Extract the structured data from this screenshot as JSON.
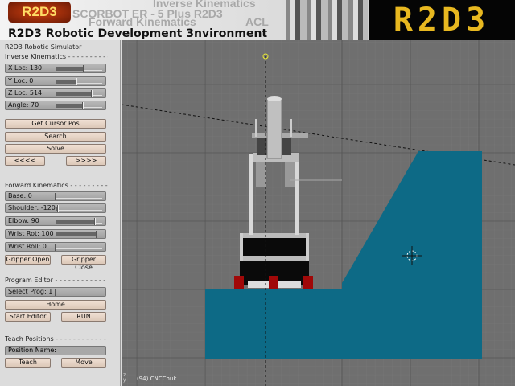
{
  "banner": {
    "logo_small": "R2D3",
    "logo_big": "R2D3",
    "ghost_texts": [
      "Inverse Kinematics",
      "SCORBOT ER - 5 Plus  R2D3",
      "Forward Kinematics",
      "ACL"
    ],
    "title": "R2D3 Robotic Development 3nvironment"
  },
  "panel": {
    "title": "R2D3 Robotic Simulator",
    "ik": {
      "heading": "Inverse Kinematics",
      "sliders": [
        {
          "label": "X Loc: 130",
          "value": 0.6
        },
        {
          "label": "Y Loc: 0",
          "value": 0.45
        },
        {
          "label": "Z Loc: 514",
          "value": 0.78
        },
        {
          "label": "Angle: 70",
          "value": 0.58
        }
      ],
      "get_cursor": "Get Cursor Pos",
      "search": "Search",
      "solve": "Solve",
      "prev": "<<<<",
      "next": ">>>>"
    },
    "fk": {
      "heading": "Forward Kinematics",
      "sliders": [
        {
          "label": "Base: 0",
          "value": 0.0
        },
        {
          "label": "Shoulder: -120",
          "value": 0.05
        },
        {
          "label": "Elbow: 90",
          "value": 0.85
        },
        {
          "label": "Wrist Rot: 100",
          "value": 0.88
        },
        {
          "label": "Wrist Roll: 0",
          "value": 0.0
        }
      ],
      "gripper_open": "Gripper Open",
      "gripper_close": "Gripper Close"
    },
    "prog": {
      "heading": "Program Editor",
      "select": {
        "label": "Select Prog: 1",
        "value": 0.0
      },
      "home": "Home",
      "start_editor": "Start Editor",
      "run": "RUN"
    },
    "teach": {
      "heading": "Teach Positions",
      "position_name": "Position Name:",
      "teach": "Teach",
      "move": "Move"
    }
  },
  "viewport": {
    "status": "(94) CNCChuk",
    "axes": "z\ny",
    "colors": {
      "background": "#6f6f6f",
      "block": "#0d6a86",
      "robot": "#c8c8c8"
    }
  }
}
